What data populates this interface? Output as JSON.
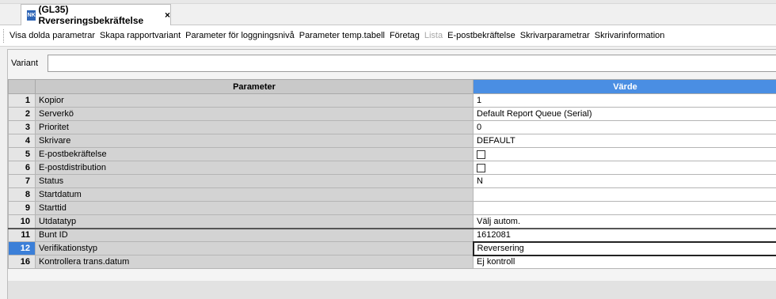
{
  "tab": {
    "badge": "NK",
    "title": "(GL35) Rverseringsbekräftelse",
    "close": "×"
  },
  "toolbar": {
    "items": [
      {
        "label": "Visa dolda parametrar"
      },
      {
        "label": "Skapa rapportvariant"
      },
      {
        "label": "Parameter för loggningsnivå"
      },
      {
        "label": "Parameter temp.tabell"
      },
      {
        "label": "Företag"
      },
      {
        "label": "Lista"
      },
      {
        "label": "E-postbekräftelse"
      },
      {
        "label": "Skrivarparametrar"
      },
      {
        "label": "Skrivarinformation"
      }
    ]
  },
  "variant": {
    "label": "Variant",
    "value": ""
  },
  "grid": {
    "header_parameter": "Parameter",
    "header_value": "Värde",
    "rows": [
      {
        "num": "1",
        "param": "Kopior",
        "value": "1"
      },
      {
        "num": "2",
        "param": "Serverkö",
        "value": "Default Report Queue (Serial)"
      },
      {
        "num": "3",
        "param": "Prioritet",
        "value": "0"
      },
      {
        "num": "4",
        "param": "Skrivare",
        "value": "DEFAULT"
      },
      {
        "num": "5",
        "param": "E-postbekräftelse",
        "value": "",
        "checkbox": true,
        "checked": false
      },
      {
        "num": "6",
        "param": "E-postdistribution",
        "value": "",
        "checkbox": true,
        "checked": false
      },
      {
        "num": "7",
        "param": "Status",
        "value": "N"
      },
      {
        "num": "8",
        "param": "Startdatum",
        "value": ""
      },
      {
        "num": "9",
        "param": "Starttid",
        "value": ""
      },
      {
        "num": "10",
        "param": "Utdatatyp",
        "value": "Välj autom."
      },
      {
        "num": "11",
        "param": "Bunt ID",
        "value": "1612081"
      },
      {
        "num": "12",
        "param": "Verifikationstyp",
        "value": "Reversering",
        "selected": true
      },
      {
        "num": "16",
        "param": "Kontrollera trans.datum",
        "value": "Ej kontroll"
      }
    ]
  }
}
